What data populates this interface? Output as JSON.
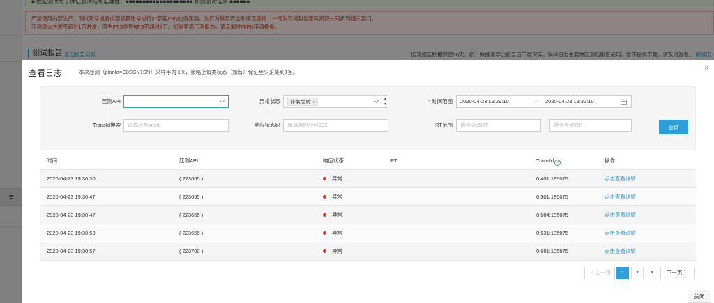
{
  "background": {
    "top_notice": "■ 性能测试为了保证测试结果准确性，■■■■■■■■■■■■■■■■■■■■ 按照测试场景 ■■■■■■",
    "warning_lines": [
      "严禁使用内部生产、测试账号或者内部核算账号进行外部客户的业务压测，进行为触及安全和廉正底线，一经发现将封禁账号资源并同步到相关部门。",
      "压测最大并发不超过1万并发，原生PTS类型RPS不超过8万。如需更高压测能力，请走邮件向PD申请报备。"
    ],
    "report_title": "测试报告",
    "report_link": "返回报告列表",
    "report_note": "压测报告数据保留30天，统计数据请导出报告后下载保存。采样日志主要做压测后排查使用，暂不提供下载，请及时查看。",
    "report_note_link": "解读压",
    "handle_icon": "≡"
  },
  "dialog": {
    "title": "查看日志",
    "subtitle": "本次压测（planId=C8SGY1SN）采样率为 1%，策略上每类状态（如有）保证至少采集到1条。",
    "close_icon": "×",
    "filters": {
      "api_label": "压测API",
      "api_value": "",
      "exception_label": "异常状态",
      "exception_tag": "业务失败",
      "exception_tag_remove": "×",
      "time_label": "时间范围",
      "time_required": "*",
      "time_start": "2020-04-23 19:29:10",
      "time_sep": "-",
      "time_end": "2020-04-23 19:32:10",
      "transid_label": "TransId搜索",
      "transid_placeholder": "请输入TransId",
      "code_label": "响应状态码",
      "code_placeholder": "如请求响应码302",
      "rt_label": "RT范围",
      "rt_min_placeholder": "最小查询RT",
      "rt_sep": "-",
      "rt_max_placeholder": "最大查询RT",
      "query_button": "查询"
    },
    "table": {
      "headers": {
        "time": "时间",
        "api": "压测API",
        "status": "响应状态",
        "rt": "RT",
        "transid": "TransId",
        "transid_help": "?",
        "op": "操作"
      },
      "rows": [
        {
          "time": "2020-04-23 19:30:30",
          "api": "( 223655 )",
          "status": "异常",
          "rt": "",
          "transid": "0:401:185075",
          "op": "点击查看详情"
        },
        {
          "time": "2020-04-23 19:30:47",
          "api": "( 223655 )",
          "status": "异常",
          "rt": "",
          "transid": "0:501:185075",
          "op": "点击查看详情"
        },
        {
          "time": "2020-04-23 19:30:47",
          "api": "( 223655 )",
          "status": "异常",
          "rt": "",
          "transid": "0:504:185075",
          "op": "点击查看详情"
        },
        {
          "time": "2020-04-23 19:30:53",
          "api": "( 223655 )",
          "status": "异常",
          "rt": "",
          "transid": "0:531:185075",
          "op": "点击查看详情"
        },
        {
          "time": "2020-04-23 19:30:57",
          "api": "( 223700 )",
          "status": "异常",
          "rt": "",
          "transid": "0:601:185075",
          "op": "点击查看详情"
        }
      ]
    },
    "pagination": {
      "prev": "〈 上一页",
      "pages": [
        "1",
        "2",
        "3"
      ],
      "current": "1",
      "next": "下一页 〉"
    },
    "close_button": "关闭"
  },
  "colors": {
    "accent": "#2b9fd9",
    "error_dot": "#d9362b",
    "warning_text": "#d0402a"
  }
}
